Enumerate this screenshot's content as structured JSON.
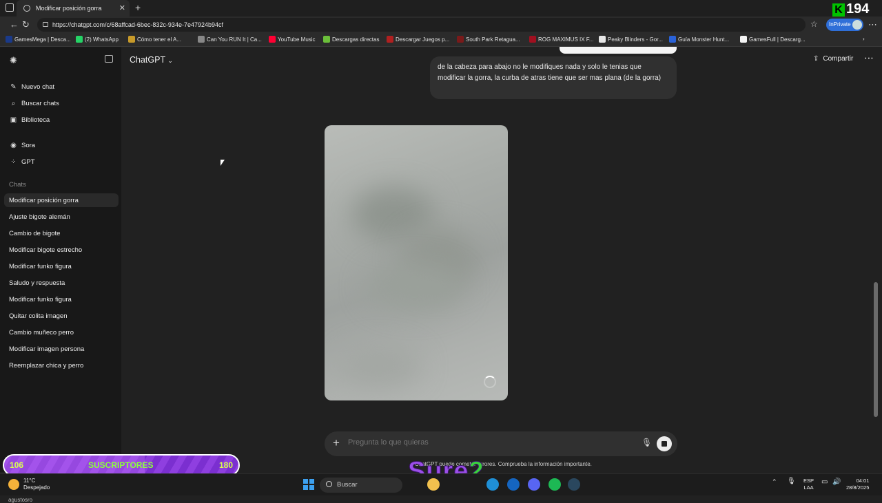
{
  "browser": {
    "tab_title": "Modificar posición gorra",
    "url": "https://chatgpt.com/c/68affcad-6bec-832c-934e-7e47924b94cf",
    "inprivate_label": "InPrivate",
    "counter": "194",
    "counter_k": "K",
    "bookmarks": [
      {
        "label": "GamesMega | Desca...",
        "color": "#1a3a8a"
      },
      {
        "label": "(2) WhatsApp",
        "color": "#25d366"
      },
      {
        "label": "Cómo tener el A...",
        "color": "#c79a2a"
      },
      {
        "label": "Can You RUN It | Ca...",
        "color": "#888888"
      },
      {
        "label": "YouTube Music",
        "color": "#ff0033"
      },
      {
        "label": "Descargas directas",
        "color": "#6bbf3a"
      },
      {
        "label": "Descargar Juegos p...",
        "color": "#b02020"
      },
      {
        "label": "South Park Retagua...",
        "color": "#7a1a1a"
      },
      {
        "label": "ROG MAXIMUS IX F...",
        "color": "#a01020"
      },
      {
        "label": "Peaky Blinders - Gor...",
        "color": "#e6e6e6"
      },
      {
        "label": "Guía Monster Hunt...",
        "color": "#2a62d8"
      },
      {
        "label": "GamesFull | Descarg...",
        "color": "#f5f5f5"
      }
    ]
  },
  "sidebar": {
    "top_items": [
      {
        "label": "Nuevo chat",
        "icon": "✎"
      },
      {
        "label": "Buscar chats",
        "icon": "⌕"
      },
      {
        "label": "Biblioteca",
        "icon": "▣"
      }
    ],
    "mid_items": [
      {
        "label": "Sora",
        "icon": "◉"
      },
      {
        "label": "GPT",
        "icon": "⁘"
      }
    ],
    "chats_label": "Chats",
    "chats": [
      "Modificar posición gorra",
      "Ajuste bigote alemán",
      "Cambio de bigote",
      "Modificar bigote estrecho",
      "Modificar funko figura",
      "Saludo y respuesta",
      "Modificar funko figura",
      "Quitar colita imagen",
      "Cambio muñeco perro",
      "Modificar imagen persona",
      "Reemplazar chica y perro"
    ],
    "user_name": "agustosro"
  },
  "main": {
    "model_label": "ChatGPT",
    "share_label": "Compartir",
    "user_message": "de la cabeza para abajo no le modifiques nada y solo le tenias que modificar la gorra, la curba de atras tiene que ser mas plana (de la gorra)",
    "input_placeholder": "Pregunta lo que quieras",
    "disclaimer": "ChatGPT puede cometer errores. Comprueba la información importante."
  },
  "overlay": {
    "subs_left": "106",
    "subs_label": "SUSCRIPTORES",
    "subs_right": "180",
    "subs_progress": 0.6,
    "watermark_a": "Sure",
    "watermark_b": "2"
  },
  "taskbar": {
    "weather_temp": "11°C",
    "weather_desc": "Despejado",
    "search_label": "Buscar",
    "lang_1": "ESP",
    "lang_2": "LAA",
    "time": "04:01",
    "date": "28/8/2025",
    "apps": [
      {
        "name": "file-explorer",
        "color": "#f2c14e"
      },
      {
        "name": "edge",
        "color": "#1f8fd6"
      },
      {
        "name": "outlook",
        "color": "#1565c0"
      },
      {
        "name": "discord",
        "color": "#5865f2"
      },
      {
        "name": "spotify",
        "color": "#1db954"
      },
      {
        "name": "steam",
        "color": "#2a475e"
      }
    ]
  }
}
